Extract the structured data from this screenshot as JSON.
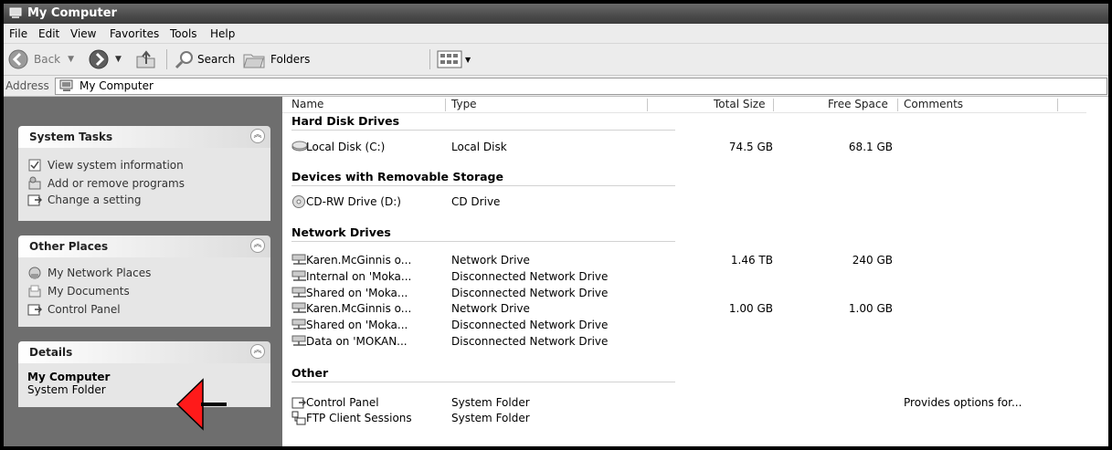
{
  "window": {
    "title": "My Computer"
  },
  "menu": [
    "File",
    "Edit",
    "View",
    "Favorites",
    "Tools",
    "Help"
  ],
  "toolbar": {
    "back_label": "Back",
    "search_label": "Search",
    "folders_label": "Folders"
  },
  "address": {
    "label": "Address",
    "value": "My Computer"
  },
  "tasks": {
    "system": {
      "title": "System Tasks",
      "items": [
        "View system information",
        "Add or remove programs",
        "Change a setting"
      ]
    },
    "other": {
      "title": "Other Places",
      "items": [
        "My Network Places",
        "My Documents",
        "Control Panel"
      ]
    },
    "details": {
      "title": "Details",
      "name": "My Computer",
      "type": "System Folder"
    }
  },
  "columns": {
    "name": "Name",
    "type": "Type",
    "total": "Total Size",
    "free": "Free Space",
    "comments": "Comments"
  },
  "groups": {
    "hdd": {
      "title": "Hard Disk Drives",
      "rows": [
        {
          "name": "Local Disk (C:)",
          "type": "Local Disk",
          "total": "74.5 GB",
          "free": "68.1 GB",
          "comments": ""
        }
      ]
    },
    "removable": {
      "title": "Devices with Removable Storage",
      "rows": [
        {
          "name": "CD-RW Drive (D:)",
          "type": "CD Drive",
          "total": "",
          "free": "",
          "comments": ""
        }
      ]
    },
    "network": {
      "title": "Network Drives",
      "rows": [
        {
          "name": "Karen.McGinnis o...",
          "type": "Network Drive",
          "total": "1.46 TB",
          "free": "240 GB",
          "comments": ""
        },
        {
          "name": "Internal on 'Moka...",
          "type": "Disconnected Network Drive",
          "total": "",
          "free": "",
          "comments": ""
        },
        {
          "name": "Shared on 'Moka...",
          "type": "Disconnected Network Drive",
          "total": "",
          "free": "",
          "comments": ""
        },
        {
          "name": "Karen.McGinnis o...",
          "type": "Network Drive",
          "total": "1.00 GB",
          "free": "1.00 GB",
          "comments": ""
        },
        {
          "name": "Shared on 'Moka...",
          "type": "Disconnected Network Drive",
          "total": "",
          "free": "",
          "comments": ""
        },
        {
          "name": "Data on 'MOKAN...",
          "type": "Disconnected Network Drive",
          "total": "",
          "free": "",
          "comments": ""
        }
      ]
    },
    "other": {
      "title": "Other",
      "rows": [
        {
          "name": "Control Panel",
          "type": "System Folder",
          "total": "",
          "free": "",
          "comments": "Provides options for..."
        },
        {
          "name": "FTP Client Sessions",
          "type": "System Folder",
          "total": "",
          "free": "",
          "comments": ""
        }
      ]
    }
  },
  "annotation": {
    "arrow_color": "#ff0000",
    "points_to": "Control Panel"
  }
}
